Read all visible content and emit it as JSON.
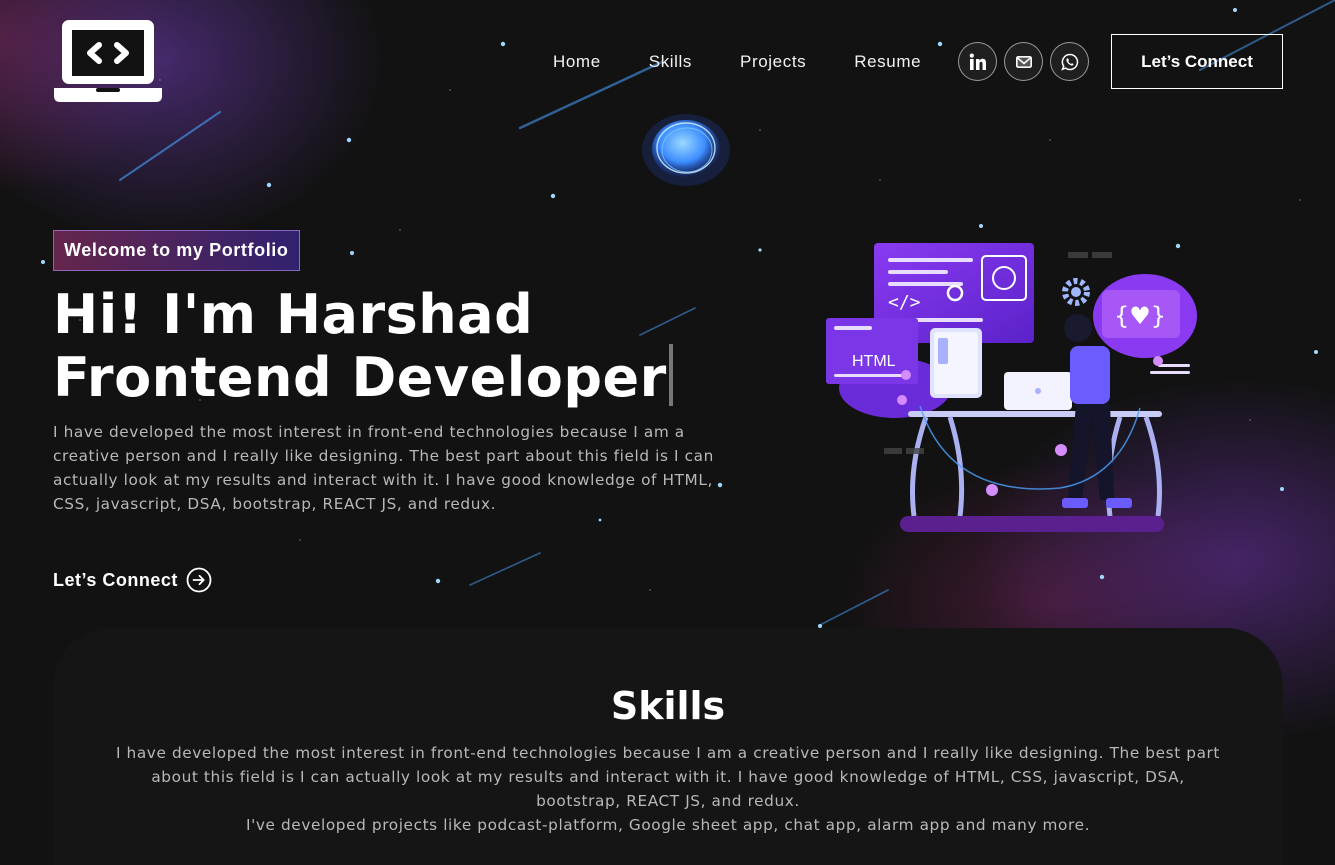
{
  "brand": {
    "logo_icon": "laptop-code-icon"
  },
  "nav": {
    "links": [
      "Home",
      "Skills",
      "Projects",
      "Resume"
    ],
    "socials": [
      {
        "icon": "linkedin-icon"
      },
      {
        "icon": "mail-icon"
      },
      {
        "icon": "whatsapp-icon"
      }
    ],
    "cta_label": "Let’s Connect"
  },
  "hero": {
    "tagline": "Welcome to my Portfolio",
    "headline_line1": "Hi! I'm Harshad",
    "headline_line2": "Frontend Developer",
    "intro": "I have developed the most interest in front-end technologies because I am a creative person and I really like designing. The best part about this field is I can actually look at my results and interact with it. I have good knowledge of HTML, CSS, javascript, DSA, bootstrap, REACT JS, and redux.",
    "cta_label": "Let’s Connect",
    "cta_icon": "arrow-right-circle-icon",
    "illustration": {
      "panel_label": "HTML",
      "code_tag": "</>",
      "braces_label": "{♥}"
    }
  },
  "skills": {
    "title": "Skills",
    "desc_line1": "I have developed the most interest in front-end technologies because I am a creative person and I really like designing. The best part about this field is I can actually look at my results and interact with it. I have good knowledge of HTML, CSS, javascript, DSA, bootstrap, REACT JS, and redux.",
    "desc_line2": "I've developed projects like podcast-platform, Google sheet app, chat app, alarm app and many more."
  },
  "colors": {
    "background": "#121212",
    "accent_purple": "#7b2ff7",
    "accent_pink": "#aa367c",
    "text_muted": "#b8b8b8"
  }
}
